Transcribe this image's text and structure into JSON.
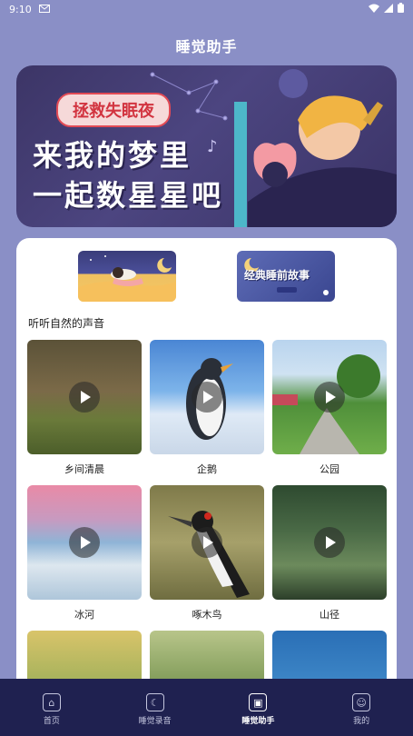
{
  "status": {
    "time": "9:10",
    "icons": [
      "gmail-icon",
      "wifi-icon",
      "signal-icon",
      "battery-icon"
    ]
  },
  "header": {
    "title": "睡觉助手"
  },
  "banner": {
    "pill": "拯救失眠夜",
    "line1": "来我的梦里",
    "line2": "一起数星星吧"
  },
  "features": {
    "right_label": "经典睡前故事"
  },
  "section": {
    "title": "听听自然的声音"
  },
  "sounds": [
    {
      "label": "乡间清晨"
    },
    {
      "label": "企鹅"
    },
    {
      "label": "公园"
    },
    {
      "label": "冰河"
    },
    {
      "label": "啄木鸟"
    },
    {
      "label": "山径"
    },
    {
      "label": ""
    },
    {
      "label": ""
    },
    {
      "label": ""
    }
  ],
  "tabs": [
    {
      "label": "首页",
      "icon": "home-icon"
    },
    {
      "label": "睡觉录音",
      "icon": "moon-record-icon"
    },
    {
      "label": "睡觉助手",
      "icon": "assistant-icon",
      "active": true
    },
    {
      "label": "我的",
      "icon": "profile-icon"
    }
  ],
  "colors": {
    "background": "#8a8fc6",
    "tabbar": "#1f2150",
    "banner": "#3c3566"
  }
}
